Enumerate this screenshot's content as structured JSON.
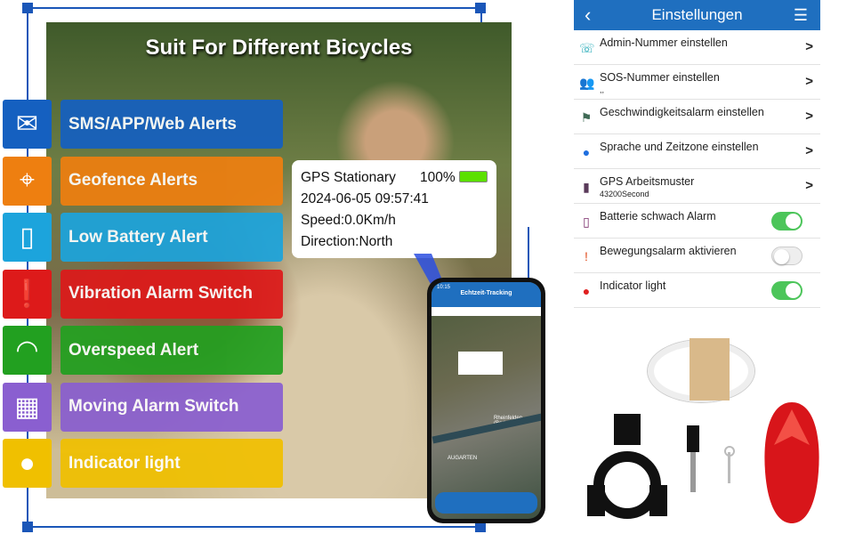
{
  "title": "Suit For Different Bicycles",
  "features": [
    {
      "label": "SMS/APP/Web Alerts",
      "icon": "envelope-icon",
      "color": "#1560c0"
    },
    {
      "label": "Geofence Alerts",
      "icon": "location-pin-icon",
      "color": "#ee7f10"
    },
    {
      "label": "Low Battery Alert",
      "icon": "battery-icon",
      "color": "#1ca4dc"
    },
    {
      "label": "Vibration Alarm Switch",
      "icon": "alert-pin-icon",
      "color": "#dd1a1a"
    },
    {
      "label": "Overspeed Alert",
      "icon": "speedometer-icon",
      "color": "#22a020"
    },
    {
      "label": "Moving Alarm Switch",
      "icon": "map-route-icon",
      "color": "#8a5fd0"
    },
    {
      "label": "Indicator light",
      "icon": "siren-icon",
      "color": "#f0c000"
    }
  ],
  "callout": {
    "status": "GPS Stationary",
    "battery": "100%",
    "battery_level": 1.0,
    "datetime": "2024-06-05 09:57:41",
    "speed": "Speed:0.0Km/h",
    "direction": "Direction:North"
  },
  "phone": {
    "time": "10:15",
    "title": "Echtzeit-Tracking",
    "places": [
      "AUGARTEN",
      "Rheinfelden (Baden)"
    ]
  },
  "settings": {
    "title": "Einstellungen",
    "items": [
      {
        "label": "Admin-Nummer einstellen",
        "icon": "phone-icon",
        "type": "link"
      },
      {
        "label": "SOS-Nummer einstellen",
        "sub": ",,",
        "icon": "people-icon",
        "type": "link"
      },
      {
        "label": "Geschwindigkeitsalarm einstellen",
        "icon": "flag-icon",
        "type": "link"
      },
      {
        "label": "Sprache und Zeitzone einstellen",
        "icon": "globe-icon",
        "type": "link"
      },
      {
        "label": "GPS Arbeitsmuster",
        "sub": "43200Second",
        "icon": "mouse-icon",
        "type": "link"
      },
      {
        "label": "Batterie schwach Alarm",
        "icon": "phone-battery-icon",
        "type": "toggle",
        "on": true
      },
      {
        "label": "Bewegungsalarm aktivieren",
        "icon": "alert-pin-icon",
        "type": "toggle",
        "on": false
      },
      {
        "label": "Indicator light",
        "icon": "siren-icon",
        "type": "toggle",
        "on": true
      }
    ]
  }
}
